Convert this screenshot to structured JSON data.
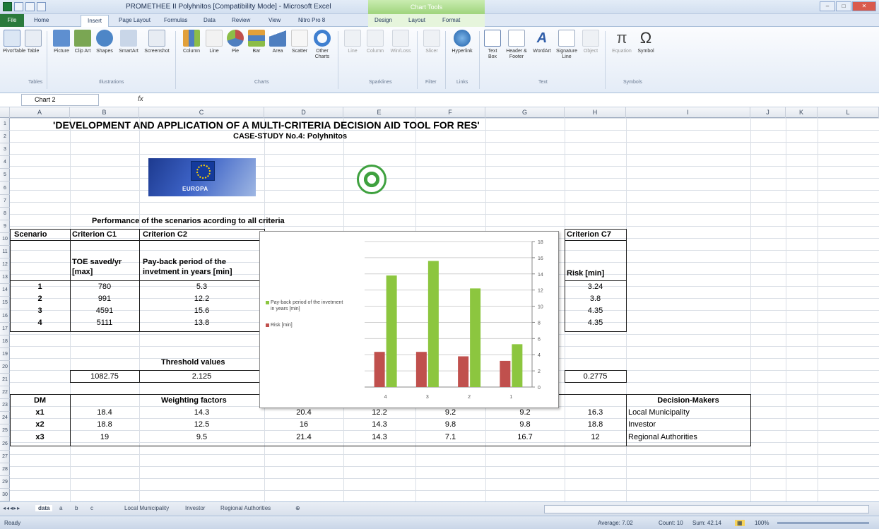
{
  "window": {
    "title": "PROMETHEE II Polyhnitos [Compatibility Mode] - Microsoft Excel",
    "chart_tools": "Chart Tools"
  },
  "ribbon_tabs": [
    "File",
    "Home",
    "Insert",
    "Page Layout",
    "Formulas",
    "Data",
    "Review",
    "View",
    "Nitro Pro 8",
    "Design",
    "Layout",
    "Format"
  ],
  "ribbon": {
    "buttons": [
      "PivotTable",
      "Table",
      "Picture",
      "Clip Art",
      "Shapes",
      "SmartArt",
      "Screenshot",
      "Column",
      "Line",
      "Pie",
      "Bar",
      "Area",
      "Scatter",
      "Other Charts",
      "Line",
      "Column",
      "Win/Loss",
      "Slicer",
      "Hyperlink",
      "Text Box",
      "Header & Footer",
      "WordArt",
      "Signature Line",
      "Object",
      "Equation",
      "Symbol"
    ],
    "groups": [
      "Tables",
      "Illustrations",
      "Charts",
      "Sparklines",
      "Filter",
      "Links",
      "Text",
      "Symbols"
    ]
  },
  "formula_bar": {
    "name_box": "Chart 2",
    "fx": "fx",
    "value": ""
  },
  "columns": [
    "A",
    "B",
    "C",
    "D",
    "E",
    "F",
    "G",
    "H",
    "I",
    "J",
    "K",
    "L"
  ],
  "rows": [
    "1",
    "2",
    "3",
    "4",
    "5",
    "6",
    "7",
    "8",
    "9",
    "10",
    "11",
    "12",
    "13",
    "14",
    "15",
    "16",
    "17",
    "18",
    "19",
    "20",
    "21",
    "22",
    "23",
    "24",
    "25",
    "26",
    "27",
    "28",
    "29",
    "30"
  ],
  "sheet": {
    "title": "'DEVELOPMENT AND APPLICATION OF A MULTI-CRITERIA DECISION AID TOOL FOR RES'",
    "subtitle": "CASE-STUDY No.4: Polyhnitos",
    "eu_label": "EUROPA",
    "perf_title": "Performance of the scenarios acording to all criteria",
    "hdr_scenario": "Scenario",
    "hdr_c1": "Criterion C1",
    "hdr_c2": "Criterion C2",
    "hdr_c7": "Criterion C7",
    "sub_c1": "TOE saved/yr [max]",
    "sub_c2": "Pay-back period of the invetment in years [min]",
    "sub_c7": "Risk [min]",
    "perf_rows": [
      {
        "s": "1",
        "c1": "780",
        "c2": "5.3",
        "c7": "3.24"
      },
      {
        "s": "2",
        "c1": "991",
        "c2": "12.2",
        "c7": "3.8"
      },
      {
        "s": "3",
        "c1": "4591",
        "c2": "15.6",
        "c7": "4.35"
      },
      {
        "s": "4",
        "c1": "5111",
        "c2": "13.8",
        "c7": "4.35"
      }
    ],
    "threshold_title": "Threshold values",
    "thr_b": "1082.75",
    "thr_c": "2.125",
    "thr_h": "0.2775",
    "dm_hdr": "DM",
    "wf_title": "Weighting factors",
    "dm_title": "Decision-Makers",
    "wf_rows": [
      {
        "dm": "x1",
        "v": [
          "18.4",
          "14.3",
          "20.4",
          "12.2",
          "9.2",
          "9.2",
          "16.3"
        ],
        "name": "Local Municipality"
      },
      {
        "dm": "x2",
        "v": [
          "18.8",
          "12.5",
          "16",
          "14.3",
          "9.8",
          "9.8",
          "18.8"
        ],
        "name": "Investor"
      },
      {
        "dm": "x3",
        "v": [
          "19",
          "9.5",
          "21.4",
          "14.3",
          "7.1",
          "16.7",
          "12"
        ],
        "name": "Regional Authorities"
      }
    ]
  },
  "chart_data": {
    "type": "bar",
    "categories": [
      "4",
      "3",
      "2",
      "1"
    ],
    "series": [
      {
        "name": "Pay-back period of the invetment in years [min]",
        "color": "#8cc63f",
        "values": [
          13.8,
          15.6,
          12.2,
          5.3
        ]
      },
      {
        "name": "Risk [min]",
        "color": "#c0504d",
        "values": [
          4.35,
          4.35,
          3.8,
          3.24
        ]
      }
    ],
    "ylim": [
      0,
      18
    ],
    "yticks": [
      "0",
      "2",
      "4",
      "6",
      "8",
      "10",
      "12",
      "14",
      "16",
      "18"
    ],
    "legend_position": "left",
    "grid": true
  },
  "sheet_tabs": [
    "data",
    "a",
    "b",
    "c",
    "Local Municipality",
    "Investor",
    "Regional Authorities"
  ],
  "status": {
    "ready": "Ready",
    "average": "Average: 7.02",
    "count": "Count: 10",
    "sum": "Sum: 42.14",
    "zoom": "100%"
  }
}
